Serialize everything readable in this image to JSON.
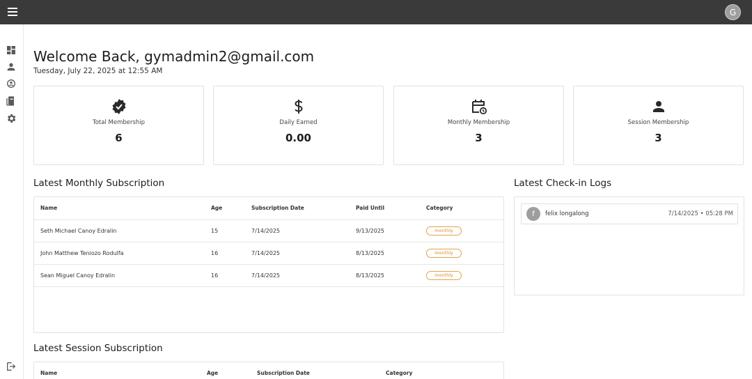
{
  "header": {
    "avatar_initial": "G",
    "menu_icon": "menu-icon"
  },
  "sidebar": {
    "items": [
      "dashboard-icon",
      "person-icon",
      "sync-icon",
      "book-icon",
      "settings-icon"
    ],
    "logout_icon": "logout-icon"
  },
  "welcome": {
    "title": "Welcome Back, gymadmin2@gmail.com",
    "date": "Tuesday, July 22, 2025 at 12:55 AM"
  },
  "stats": [
    {
      "icon": "verified-icon",
      "label": "Total Membership",
      "value": "6"
    },
    {
      "icon": "dollar-icon",
      "label": "Daily Earned",
      "value": "0.00"
    },
    {
      "icon": "calendar-clock-icon",
      "label": "Monthly Membership",
      "value": "3"
    },
    {
      "icon": "person-icon",
      "label": "Session Membership",
      "value": "3"
    }
  ],
  "monthly": {
    "title": "Latest Monthly Subscription",
    "headers": {
      "name": "Name",
      "age": "Age",
      "sub_date": "Subscription Date",
      "paid_until": "Paid Until",
      "category": "Category"
    },
    "rows": [
      {
        "name": "Seth Michael Canoy Edralin",
        "age": "15",
        "sub_date": "7/14/2025",
        "paid_until": "9/13/2025",
        "category": "monthly"
      },
      {
        "name": "John Matthew Teniozo Rodulfa",
        "age": "16",
        "sub_date": "7/14/2025",
        "paid_until": "8/13/2025",
        "category": "monthly"
      },
      {
        "name": "Sean Miguel Canoy Edralin",
        "age": "16",
        "sub_date": "7/14/2025",
        "paid_until": "8/13/2025",
        "category": "monthly"
      }
    ]
  },
  "checkins": {
    "title": "Latest Check-in Logs",
    "items": [
      {
        "initial": "f",
        "name": "felix longalong",
        "time": "7/14/2025 • 05:28 PM"
      }
    ]
  },
  "session": {
    "title": "Latest Session Subscription",
    "headers": {
      "name": "Name",
      "age": "Age",
      "sub_date": "Subscription Date",
      "category": "Category"
    }
  },
  "colors": {
    "topbar": "#3a3a3a",
    "badge": "#e0a24a"
  }
}
